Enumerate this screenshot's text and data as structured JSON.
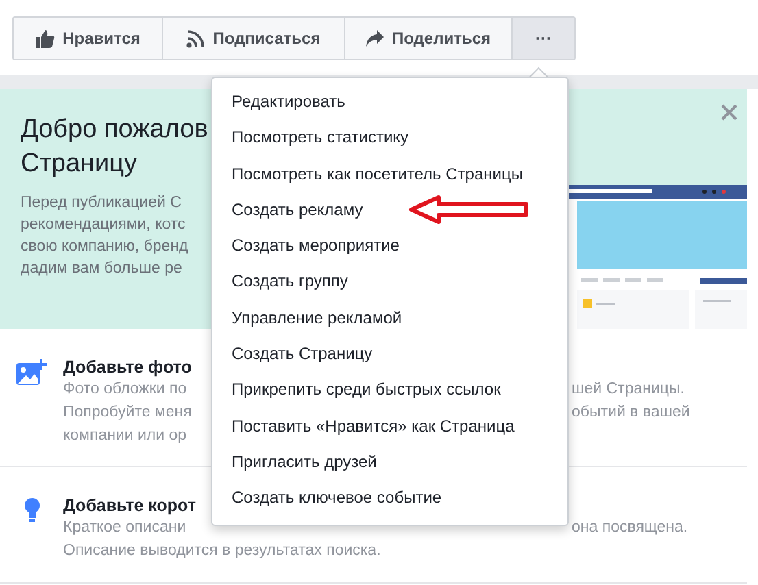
{
  "actions": [
    {
      "label": "Нравится",
      "kind": "like"
    },
    {
      "label": "Подписаться",
      "kind": "follow"
    },
    {
      "label": "Поделиться",
      "kind": "share"
    },
    {
      "label": "···",
      "kind": "more",
      "selected": true
    }
  ],
  "welcome": {
    "title_lines": [
      "Добро пожалов",
      "Страницу"
    ],
    "text_lines": [
      "Перед публикацией С",
      "рекомендациями, котс",
      "свою компанию, бренд",
      "дадим вам больше ре"
    ]
  },
  "tips": [
    {
      "kind": "photo",
      "title": "Добавьте фото",
      "left_lines": [
        "Фото обложки по",
        "Попробуйте меня",
        "компании или ор"
      ],
      "right_lines": [
        "шей Страницы.",
        "обытий в вашей"
      ]
    },
    {
      "kind": "idea",
      "title": "Добавьте корот",
      "left_lines": [
        "Краткое описани",
        "Описание выводится в результатах поиска."
      ],
      "right_lines": [
        "она посвящена."
      ]
    }
  ],
  "menu": [
    "Редактировать",
    "Посмотреть статистику",
    "Посмотреть как посетитель Страницы",
    "Создать рекламу",
    "Создать мероприятие",
    "Создать группу",
    "Управление рекламой",
    "Создать Страницу",
    "Прикрепить среди быстрых ссылок",
    "Поставить «Нравится» как Страница",
    "Пригласить друзей",
    "Создать ключевое событие"
  ]
}
